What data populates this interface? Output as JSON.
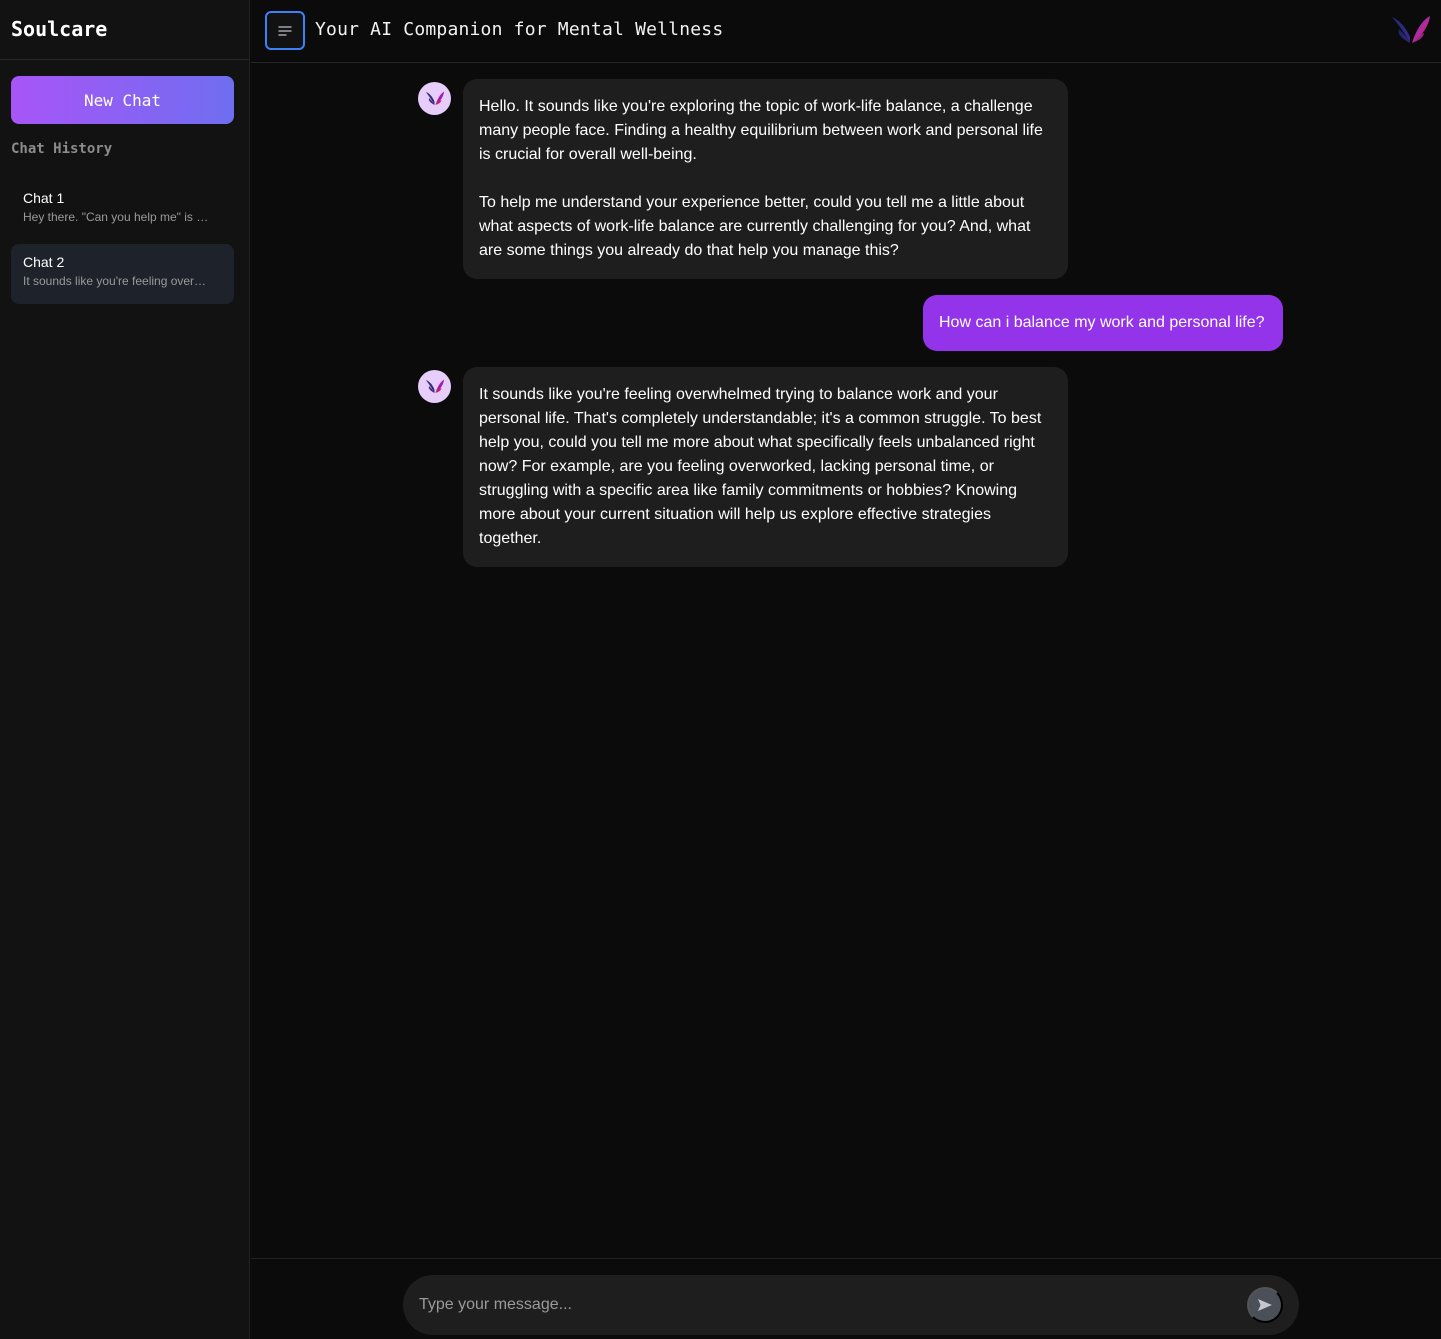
{
  "sidebar": {
    "brand": "Soulcare",
    "new_chat_label": "New Chat",
    "history_label": "Chat History",
    "items": [
      {
        "title": "Chat 1",
        "preview": "Hey there. \"Can you help me\" is …",
        "active": false
      },
      {
        "title": "Chat 2",
        "preview": "It sounds like you're feeling over…",
        "active": true
      }
    ]
  },
  "header": {
    "menu_icon": "menu-lines-icon",
    "title": "Your AI Companion for Mental Wellness",
    "logo_icon": "butterfly-logo-icon"
  },
  "messages": [
    {
      "role": "assistant",
      "paragraphs": [
        "Hello.  It sounds like you're exploring the topic of work-life balance, a challenge many people face.  Finding a healthy equilibrium between work and personal life is crucial for overall well-being.",
        "To help me understand your experience better, could you tell me a little about what aspects of work-life balance are currently challenging for you?  And, what are some things you already do that help you manage this?"
      ]
    },
    {
      "role": "user",
      "text": "How can i balance my work and personal life?"
    },
    {
      "role": "assistant",
      "paragraphs": [
        "It sounds like you're feeling overwhelmed trying to balance work and your personal life. That's completely understandable;  it's a common struggle.  To best help you, could you tell me more about what specifically feels unbalanced right now?  For example, are you feeling overworked, lacking personal time, or struggling with a specific area like family commitments or hobbies?  Knowing more about your current situation will help us explore effective strategies together."
      ]
    }
  ],
  "composer": {
    "placeholder": "Type your message...",
    "value": "",
    "send_icon": "send-arrow-icon"
  },
  "colors": {
    "accent": "#9333ea",
    "gradient_start": "#a855f7",
    "gradient_end": "#6f6ef0",
    "background": "#0b0b0b",
    "bubble": "#1e1e1e"
  }
}
